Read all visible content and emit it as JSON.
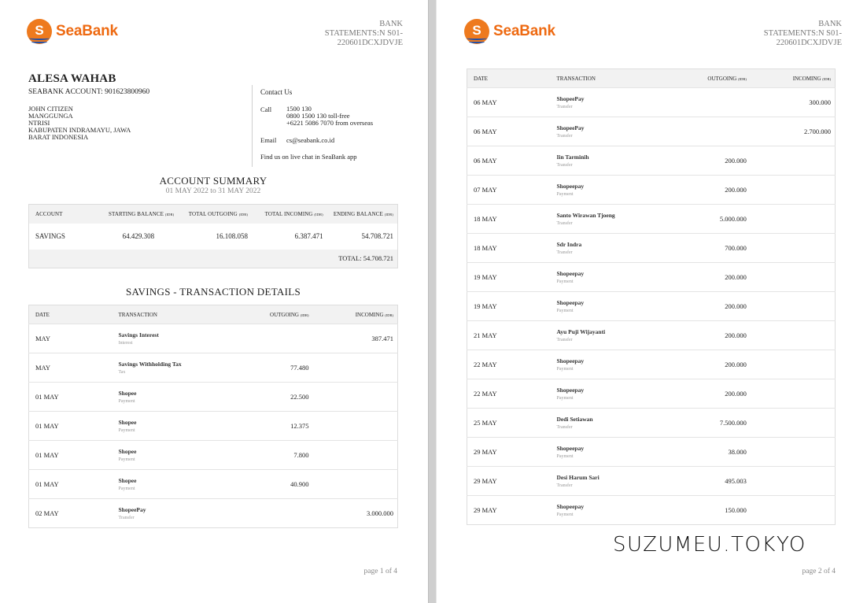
{
  "brand": {
    "logo_letter": "S",
    "logo_text": "SeaBank",
    "accent": "#ee6a12",
    "wave": "#1f4fa8"
  },
  "statement_header": {
    "line1": "BANK",
    "line2": "STATEMENTS:N  S01-",
    "line3": "220601DCXJDVJE"
  },
  "customer": {
    "name": "ALESA WAHAB",
    "account": "SEABANK ACCOUNT: 901623800960",
    "address": [
      "JOHN CITIZEN",
      "MANGGUNGA",
      "NTRISI",
      "KABUPATEN INDRAMAYU, JAWA",
      "BARAT INDONESIA"
    ]
  },
  "contact": {
    "title": "Contact Us",
    "call_label": "Call",
    "call_lines": [
      "1500 130",
      "0800 1500 130 toll-free",
      "+6221 5086 7070 from overseas"
    ],
    "email_label": "Email",
    "email": "cs@seabank.co.id",
    "chat": "Find us on live chat in SeaBank app"
  },
  "summary": {
    "title": "ACCOUNT SUMMARY",
    "period": "01 MAY 2022 to 31 MAY 2022",
    "headers": {
      "account": "ACCOUNT",
      "starting": "STARTING BALANCE",
      "outgoing": "TOTAL OUTGOING",
      "incoming": "TOTAL INCOMING",
      "ending": "ENDING BALANCE",
      "unit": "(IDR)"
    },
    "row": {
      "account": "SAVINGS",
      "starting": "64.429.308",
      "outgoing": "16.108.058",
      "incoming": "6.387.471",
      "ending": "54.708.721"
    },
    "total": "TOTAL: 54.708.721"
  },
  "details": {
    "title": "SAVINGS - TRANSACTION DETAILS",
    "headers": {
      "date": "DATE",
      "transaction": "TRANSACTION",
      "outgoing": "OUTGOING",
      "incoming": "INCOMING",
      "unit": "(IDR)"
    }
  },
  "transactions_page1": [
    {
      "date": "MAY",
      "desc": "Savings  Interest",
      "type": "Interest",
      "outgoing": "",
      "incoming": "387.471"
    },
    {
      "date": "MAY",
      "desc": "Savings Withholding Tax",
      "type": "Tax",
      "outgoing": "77.480",
      "incoming": ""
    },
    {
      "date": "01 MAY",
      "desc": "Shopee",
      "type": "Payment",
      "outgoing": "22.500",
      "incoming": ""
    },
    {
      "date": "01 MAY",
      "desc": "Shopee",
      "type": "Payment",
      "outgoing": "12.375",
      "incoming": ""
    },
    {
      "date": "01 MAY",
      "desc": "Shopee",
      "type": "Payment",
      "outgoing": "7.800",
      "incoming": ""
    },
    {
      "date": "01 MAY",
      "desc": "Shopee",
      "type": "Payment",
      "outgoing": "40.900",
      "incoming": ""
    },
    {
      "date": "02 MAY",
      "desc": "ShopeePay",
      "type": "Transfer",
      "outgoing": "",
      "incoming": "3.000.000"
    }
  ],
  "transactions_page2": [
    {
      "date": "06 MAY",
      "desc": "ShopeePay",
      "type": "Transfer",
      "outgoing": "",
      "incoming": "300.000"
    },
    {
      "date": "06 MAY",
      "desc": "ShopeePay",
      "type": "Transfer",
      "outgoing": "",
      "incoming": "2.700.000"
    },
    {
      "date": "06 MAY",
      "desc": "Iin Tarminih",
      "type": "Transfer",
      "outgoing": "200.000",
      "incoming": ""
    },
    {
      "date": "07 MAY",
      "desc": "Shopeepay",
      "type": "Payment",
      "outgoing": "200.000",
      "incoming": ""
    },
    {
      "date": "18 MAY",
      "desc": "Santo Wirawan Tjoeng",
      "type": "Transfer",
      "outgoing": "5.000.000",
      "incoming": ""
    },
    {
      "date": "18 MAY",
      "desc": "Sdr Indra",
      "type": "Transfer",
      "outgoing": "700.000",
      "incoming": ""
    },
    {
      "date": "19 MAY",
      "desc": "Shopeepay",
      "type": "Payment",
      "outgoing": "200.000",
      "incoming": ""
    },
    {
      "date": "19 MAY",
      "desc": "Shopeepay",
      "type": "Payment",
      "outgoing": "200.000",
      "incoming": ""
    },
    {
      "date": "21 MAY",
      "desc": "Ayu Puji Wijayanti",
      "type": "Transfer",
      "outgoing": "200.000",
      "incoming": ""
    },
    {
      "date": "22 MAY",
      "desc": "Shopeepay",
      "type": "Payment",
      "outgoing": "200.000",
      "incoming": ""
    },
    {
      "date": "22 MAY",
      "desc": "Shopeepay",
      "type": "Payment",
      "outgoing": "200.000",
      "incoming": ""
    },
    {
      "date": "25 MAY",
      "desc": "Dedi Setiawan",
      "type": "Transfer",
      "outgoing": "7.500.000",
      "incoming": ""
    },
    {
      "date": "29 MAY",
      "desc": "Shopeepay",
      "type": "Payment",
      "outgoing": "38.000",
      "incoming": ""
    },
    {
      "date": "29 MAY",
      "desc": "Desi Harum Sari",
      "type": "Transfer",
      "outgoing": "495.003",
      "incoming": ""
    },
    {
      "date": "29 MAY",
      "desc": "Shopeepay",
      "type": "Payment",
      "outgoing": "150.000",
      "incoming": ""
    }
  ],
  "pages": {
    "p1": "page 1 of 4",
    "p2": "page 2 of 4"
  },
  "watermark": "SUZUMEU.TOKYO"
}
